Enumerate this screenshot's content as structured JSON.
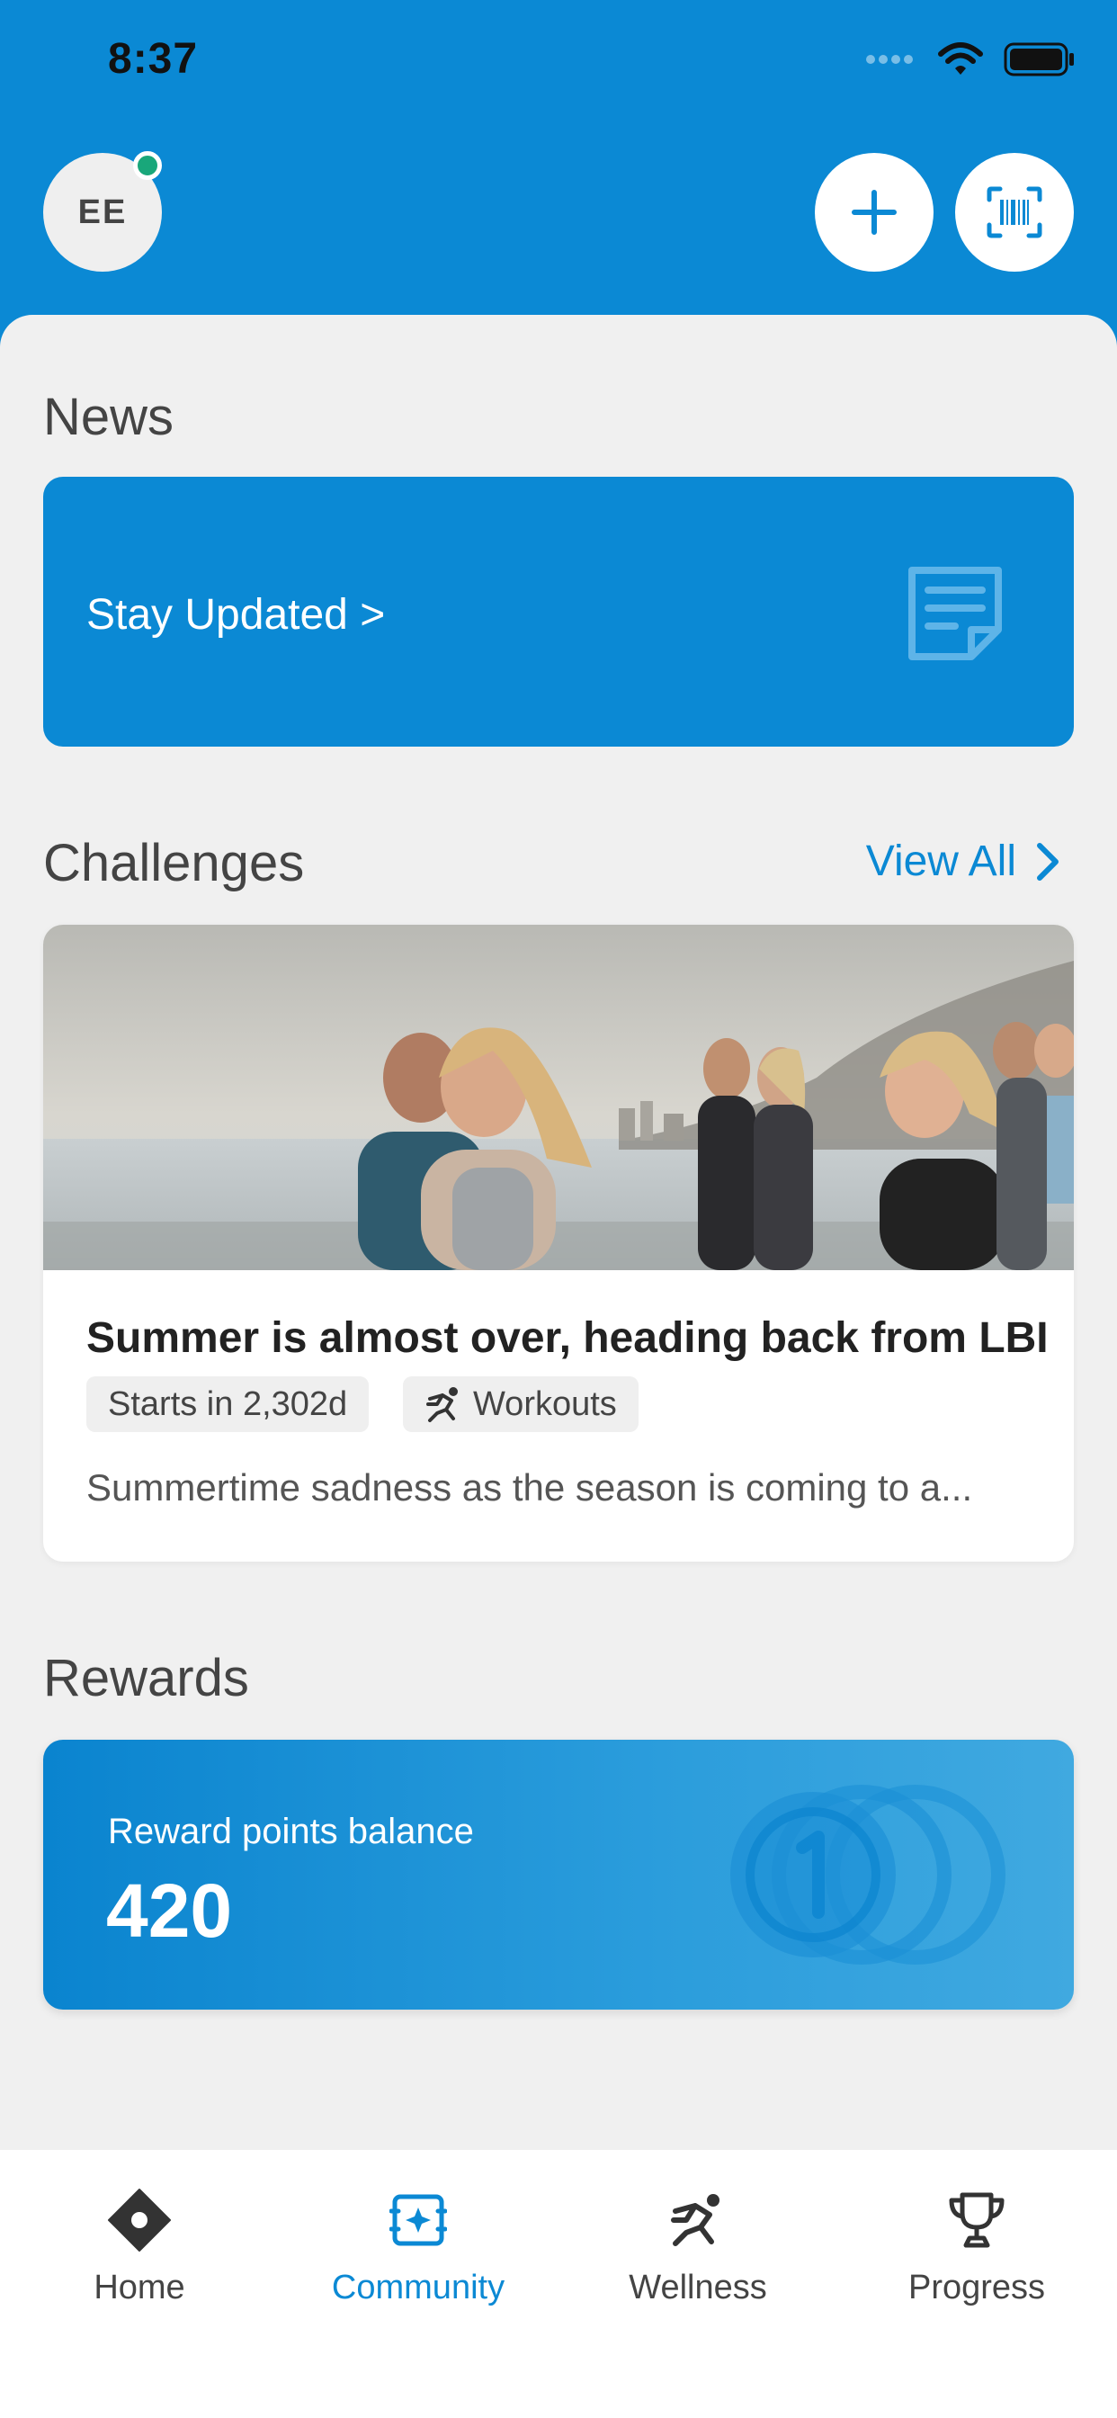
{
  "status_bar": {
    "time": "8:37"
  },
  "header": {
    "avatar_initials": "EE",
    "add_icon": "plus-icon",
    "scan_icon": "barcode-scan-icon"
  },
  "news": {
    "title": "News",
    "card_label": "Stay Updated >",
    "card_icon": "document-icon"
  },
  "challenges": {
    "title": "Challenges",
    "view_all": "View All",
    "card": {
      "title": "Summer is almost over, heading back from LBI",
      "starts_tag": "Starts in 2,302d",
      "category_tag": "Workouts",
      "description": "Summertime sadness as the season is coming to a..."
    }
  },
  "rewards": {
    "title": "Rewards",
    "label": "Reward points balance",
    "value": "420"
  },
  "tab_bar": {
    "tabs": [
      {
        "label": "Home",
        "icon": "home-diamond-icon",
        "active": false
      },
      {
        "label": "Community",
        "icon": "community-icon",
        "active": true
      },
      {
        "label": "Wellness",
        "icon": "runner-icon",
        "active": false
      },
      {
        "label": "Progress",
        "icon": "trophy-icon",
        "active": false
      }
    ]
  },
  "colors": {
    "brand": "#0b89d4",
    "online": "#19a77a",
    "background": "#f0f0f0"
  }
}
